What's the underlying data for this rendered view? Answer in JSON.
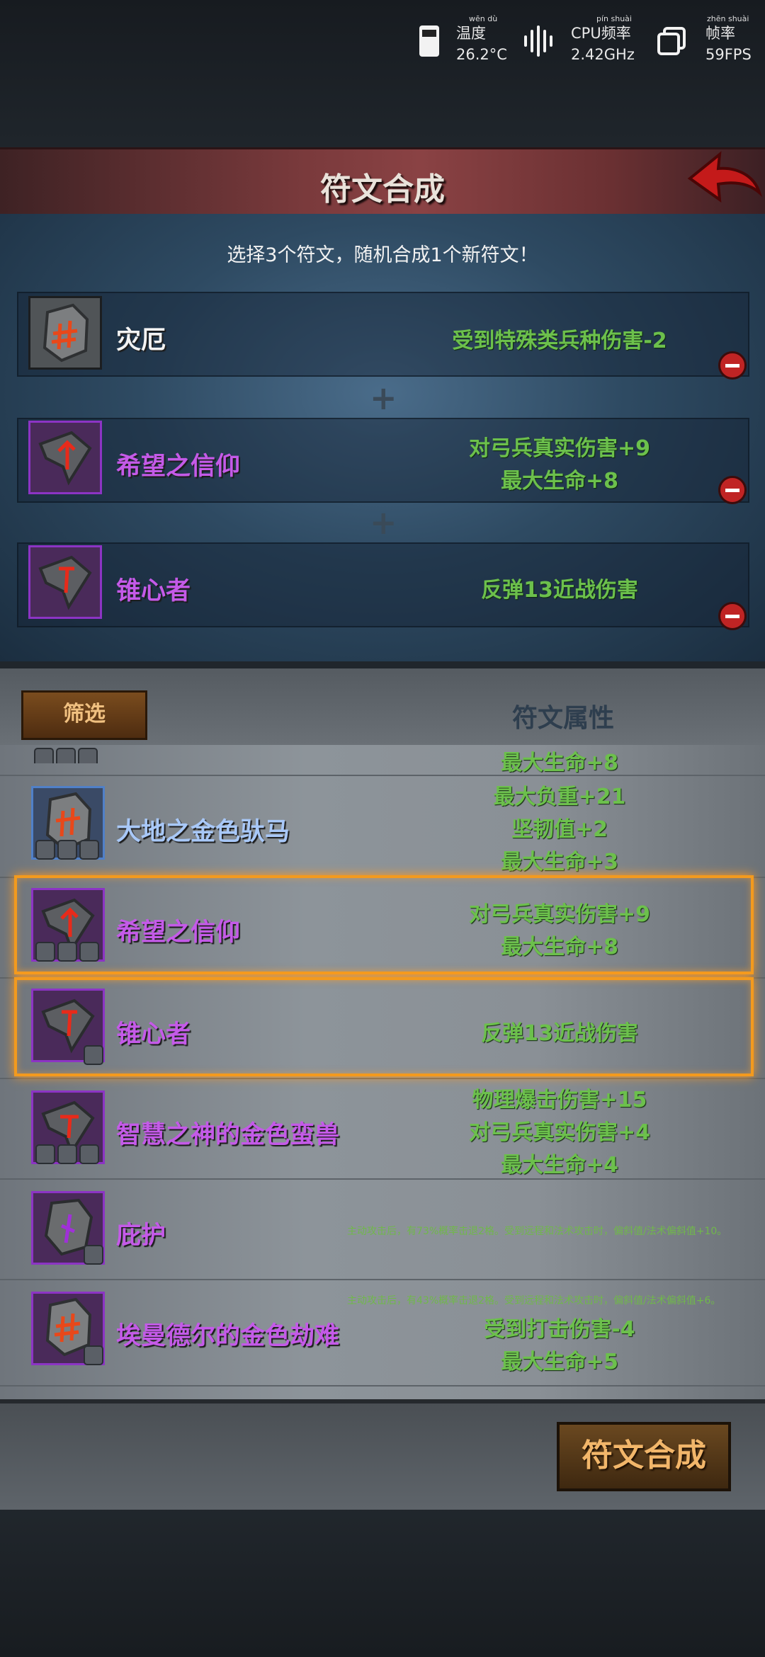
{
  "status_bar": {
    "temp_label": "温度",
    "temp_pinyin": "wēn dù",
    "temp_value": "26.2°C",
    "cpu_label": "CPU频率",
    "cpu_pinyin": "pín shuài",
    "cpu_value": "2.42GHz",
    "fps_label": "帧率",
    "fps_pinyin": "zhēn shuài",
    "fps_value": "59FPS"
  },
  "header": {
    "title": "符文合成"
  },
  "synth": {
    "hint": "选择3个符文，随机合成1个新符文！",
    "slots": [
      {
        "name": "灾厄",
        "attrs": [
          "受到特殊类兵种伤害-2"
        ]
      },
      {
        "name": "希望之信仰",
        "attrs": [
          "对弓兵真实伤害+9",
          "最大生命+8"
        ]
      },
      {
        "name": "锥心者",
        "attrs": [
          "反弹13近战伤害"
        ]
      }
    ]
  },
  "list": {
    "filter_label": "筛选",
    "attr_header": "符文属性",
    "partial_attr": "最大生命+8",
    "items": [
      {
        "name": "大地之金色驮马",
        "attrs": [
          "最大负重+21",
          "坚韧值+2",
          "最大生命+3"
        ]
      },
      {
        "name": "希望之信仰",
        "attrs": [
          "对弓兵真实伤害+9",
          "最大生命+8"
        ]
      },
      {
        "name": "锥心者",
        "attrs": [
          "反弹13近战伤害"
        ]
      },
      {
        "name": "智慧之神的金色蛮兽",
        "attrs": [
          "物理爆击伤害+15",
          "对弓兵真实伤害+4",
          "最大生命+4"
        ]
      },
      {
        "name": "庇护",
        "small": "主动攻击后，有73%概率击退2格。受到远程和法术攻击时，偏斜值/法术偏斜值+10。"
      },
      {
        "name": "埃曼德尔的金色劫难",
        "small": "主动攻击后，有43%概率击退2格。受到远程和法术攻击时，偏斜值/法术偏斜值+6。",
        "attrs": [
          "受到打击伤害-4",
          "最大生命+5"
        ]
      }
    ]
  },
  "footer": {
    "synth_button": "符文合成"
  },
  "colors": {
    "purple": "#c45ae8",
    "green": "#6cc04c",
    "selected_border": "#f39a1e",
    "remove": "#c02424"
  }
}
